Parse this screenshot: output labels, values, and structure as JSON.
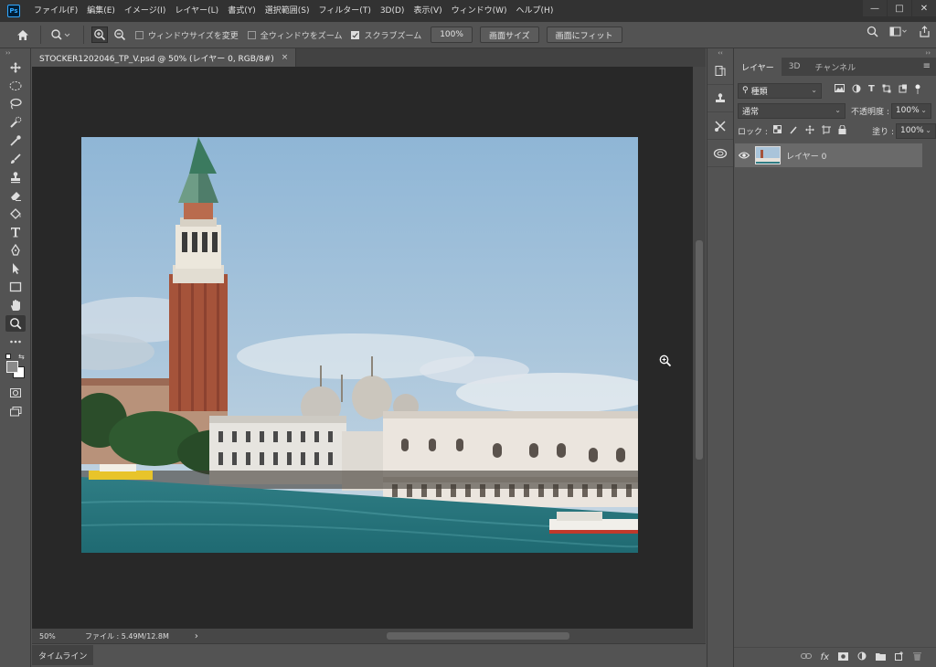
{
  "app": {
    "logo": "Ps"
  },
  "menu": [
    "ファイル(F)",
    "編集(E)",
    "イメージ(I)",
    "レイヤー(L)",
    "書式(Y)",
    "選択範囲(S)",
    "フィルター(T)",
    "3D(D)",
    "表示(V)",
    "ウィンドウ(W)",
    "ヘルプ(H)"
  ],
  "window_controls": {
    "minimize": "—",
    "maximize": "□",
    "close": "✕"
  },
  "options": {
    "resize_windows": {
      "label": "ウィンドウサイズを変更",
      "checked": false
    },
    "zoom_all": {
      "label": "全ウィンドウをズーム",
      "checked": false
    },
    "scrubby_zoom": {
      "label": "スクラブズーム",
      "checked": true
    },
    "btn_100": "100%",
    "btn_fit_screen": "画面サイズ",
    "btn_fill_screen": "画面にフィット"
  },
  "document": {
    "tab_title": "STOCKER1202046_TP_V.psd @ 50% (レイヤー 0, RGB/8#)",
    "close": "×",
    "zoom": "50%",
    "file_info": "ファイル : 5.49M/12.8M",
    "status_arrow": "›"
  },
  "timeline": {
    "label": "タイムライン"
  },
  "panel": {
    "tabs": [
      "レイヤー",
      "3D",
      "チャンネル"
    ],
    "active_tab": 0,
    "filter_kind": "種類",
    "blend_mode": "通常",
    "opacity_label": "不透明度 :",
    "opacity_value": "100%",
    "lock_label": "ロック :",
    "fill_label": "塗り :",
    "fill_value": "100%",
    "layers": [
      {
        "name": "レイヤー 0",
        "visible": true
      }
    ]
  },
  "colors": {
    "accent": "#31a8ff",
    "canvas_bg": "#282828",
    "panel_bg": "#535353",
    "menubar_bg": "#323232"
  }
}
